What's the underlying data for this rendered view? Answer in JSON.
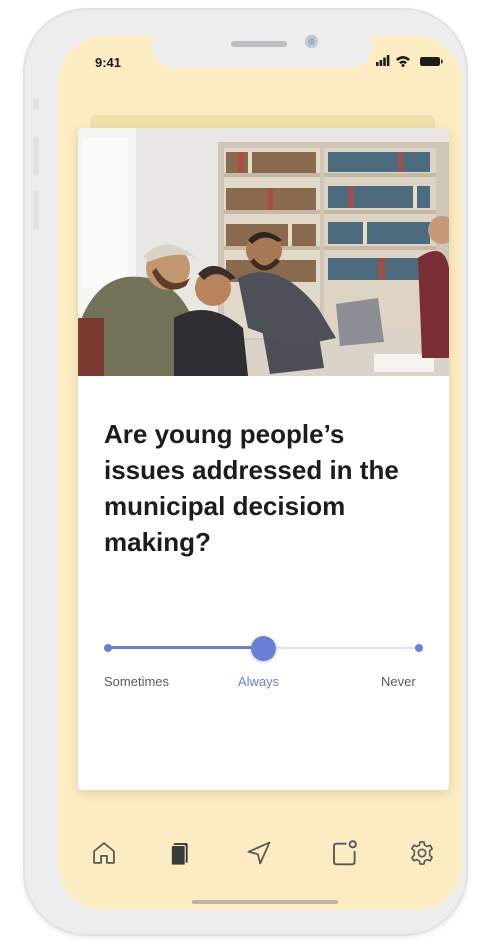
{
  "status_bar": {
    "time": "9:41",
    "icons": [
      "signal-icon",
      "wifi-icon",
      "battery-icon"
    ]
  },
  "card": {
    "image": {
      "subject": "photo of young people working together at a table with laptops in front of bookshelves"
    },
    "question": "Are young people’s issues addressed in the municipal decisiom making?",
    "slider": {
      "options": [
        "Sometimes",
        "Always",
        "Never"
      ],
      "selected": "Always",
      "position": 0.5
    }
  },
  "tab_bar": {
    "items": [
      {
        "icon": "home-icon"
      },
      {
        "icon": "cards-icon"
      },
      {
        "icon": "navigate-arrow-icon"
      },
      {
        "icon": "notification-square-icon"
      },
      {
        "icon": "gear-icon"
      }
    ]
  },
  "colors": {
    "screen_background": "#fcecc1",
    "accent": "#6b7fd7",
    "text": "#1c1c1c"
  }
}
